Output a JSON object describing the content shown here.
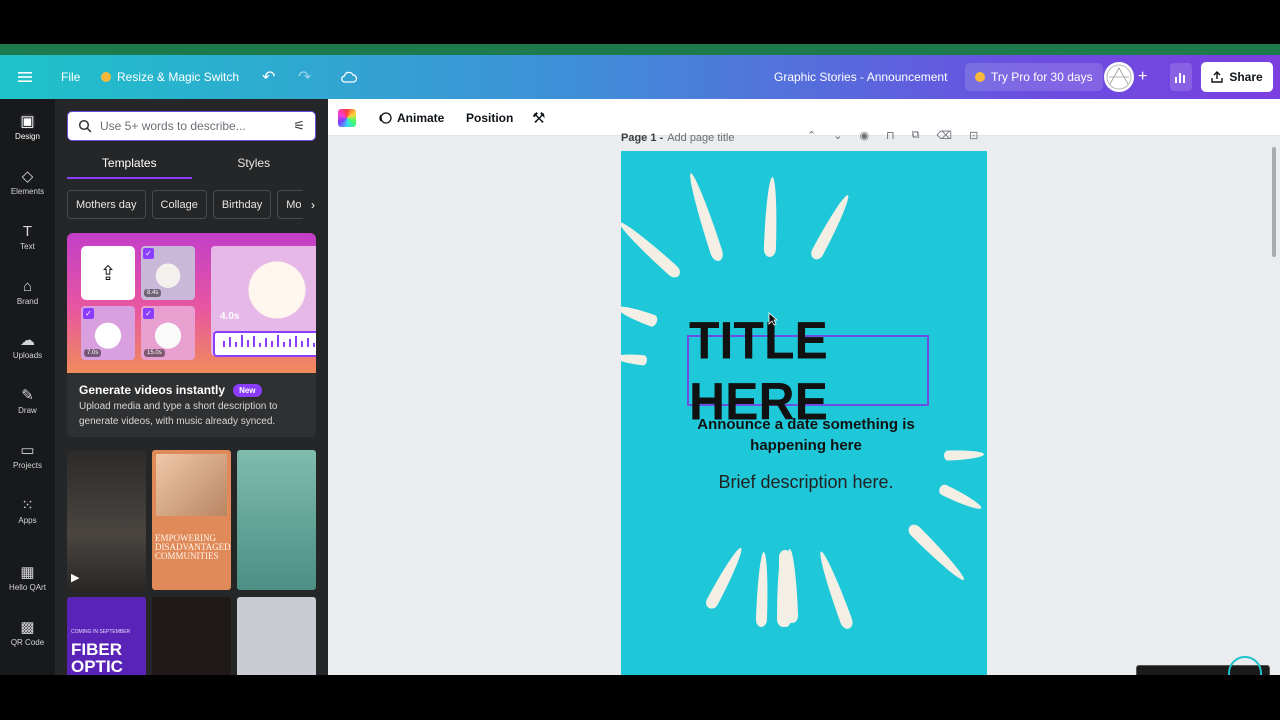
{
  "topbar": {
    "file_label": "File",
    "resize_label": "Resize & Magic Switch",
    "doc_title": "Graphic Stories - Announcement",
    "try_pro_label": "Try Pro for 30 days",
    "share_label": "Share"
  },
  "rail": {
    "items": [
      {
        "label": "Design",
        "icon": "design-icon"
      },
      {
        "label": "Elements",
        "icon": "elements-icon"
      },
      {
        "label": "Text",
        "icon": "text-icon"
      },
      {
        "label": "Brand",
        "icon": "brand-icon"
      },
      {
        "label": "Uploads",
        "icon": "uploads-icon"
      },
      {
        "label": "Draw",
        "icon": "draw-icon"
      },
      {
        "label": "Projects",
        "icon": "projects-icon"
      },
      {
        "label": "Apps",
        "icon": "apps-icon"
      },
      {
        "label": "Hello QArt",
        "icon": "hello-qart-icon"
      },
      {
        "label": "QR Code",
        "icon": "qr-code-icon"
      }
    ]
  },
  "panel": {
    "search_placeholder": "Use 5+ words to describe...",
    "tabs": [
      "Templates",
      "Styles"
    ],
    "chips": [
      "Mothers day",
      "Collage",
      "Birthday",
      "Mo"
    ],
    "promo": {
      "title": "Generate videos instantly",
      "badge": "New",
      "desc": "Upload media and type a short description to generate videos, with music already synced.",
      "time_big": "4.0s",
      "time_1": "8.4s",
      "time_2": "7.0s",
      "time_3": "15.0s"
    },
    "templates": {
      "t2_text": "EMPOWERING DISADVANTAGED COMMUNITIES",
      "t4_sub": "COMING IN SEPTEMBER",
      "t4_text": "FIBER OPTIC"
    }
  },
  "context_bar": {
    "animate_label": "Animate",
    "position_label": "Position"
  },
  "page": {
    "label": "Page 1 -",
    "title_placeholder": "Add page title"
  },
  "canvas": {
    "title": "TITLE HERE",
    "announce": "Announce a date something is happening here",
    "brief": "Brief description here.",
    "bg_color": "#1ec8d8"
  }
}
